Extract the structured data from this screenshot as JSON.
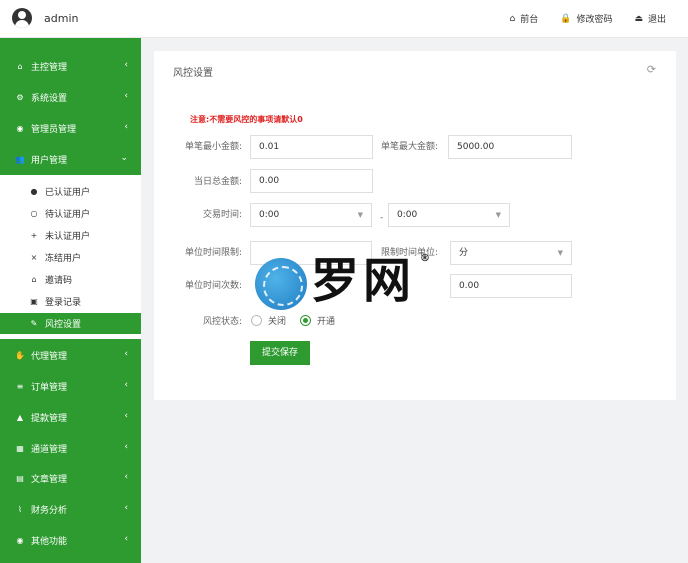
{
  "header": {
    "username": "admin",
    "links": [
      {
        "icon": "home-icon",
        "glyph": "⌂",
        "label": "前台"
      },
      {
        "icon": "lock-icon",
        "glyph": "🔒",
        "label": "修改密码"
      },
      {
        "icon": "logout-icon",
        "glyph": "⏏",
        "label": "退出"
      }
    ]
  },
  "sidebar": {
    "items": [
      {
        "label": "主控管理",
        "glyph": "⌂",
        "icon": "home-icon"
      },
      {
        "label": "系统设置",
        "glyph": "⚙",
        "icon": "cogs-icon"
      },
      {
        "label": "管理员管理",
        "glyph": "◉",
        "icon": "user-circle-icon"
      },
      {
        "label": "用户管理",
        "glyph": "👥",
        "icon": "users-icon"
      },
      {
        "label": "代理管理",
        "glyph": "✋",
        "icon": "handshake-icon"
      },
      {
        "label": "订单管理",
        "glyph": "≡",
        "icon": "list-icon"
      },
      {
        "label": "提款管理",
        "glyph": "▲",
        "icon": "withdraw-icon"
      },
      {
        "label": "通道管理",
        "glyph": "▦",
        "icon": "bank-icon"
      },
      {
        "label": "文章管理",
        "glyph": "▤",
        "icon": "book-icon"
      },
      {
        "label": "财务分析",
        "glyph": "⌇",
        "icon": "line-chart-icon"
      },
      {
        "label": "其他功能",
        "glyph": "◉",
        "icon": "more-icon"
      }
    ],
    "user_submenu": [
      {
        "label": "已认证用户",
        "glyph": "●",
        "icon": "user-icon"
      },
      {
        "label": "待认证用户",
        "glyph": "○",
        "icon": "user-outline-icon"
      },
      {
        "label": "未认证用户",
        "glyph": "+",
        "icon": "user-plus-icon"
      },
      {
        "label": "冻结用户",
        "glyph": "×",
        "icon": "user-times-icon"
      },
      {
        "label": "邀请码",
        "glyph": "⌂",
        "icon": "gift-icon"
      },
      {
        "label": "登录记录",
        "glyph": "▣",
        "icon": "record-icon"
      },
      {
        "label": "风控设置",
        "glyph": "✎",
        "icon": "wrench-icon"
      }
    ],
    "arrow_glyph": "‹",
    "arrow_down_glyph": "⌄"
  },
  "panel": {
    "title": "风控设置",
    "refresh_glyph": "⟳",
    "notice": "注意:不需要风控的事项请默认0",
    "fields": {
      "min_single": {
        "label": "单笔最小金额:",
        "value": "0.01"
      },
      "max_single": {
        "label": "单笔最大金额:",
        "value": "5000.00"
      },
      "daily_total": {
        "label": "当日总金额:",
        "value": "0.00"
      },
      "trade_time": {
        "label": "交易时间:",
        "start": "0:00",
        "end": "0:00",
        "separator": "-"
      },
      "unit_time_limit": {
        "label": "单位时间限制:",
        "value": ""
      },
      "time_unit": {
        "label": "限制时间单位:",
        "value": "分"
      },
      "unit_time_count": {
        "label": "单位时间次数:",
        "value": "0.00"
      },
      "status": {
        "label": "风控状态:",
        "options": [
          "关闭",
          "开通"
        ],
        "selected": "开通"
      }
    },
    "submit_label": "提交保存"
  },
  "watermark": {
    "text": "罗网",
    "reg": "®"
  },
  "colors": {
    "primary": "#2e9b31",
    "notice": "#e02020",
    "background": "#f1f2f4"
  }
}
